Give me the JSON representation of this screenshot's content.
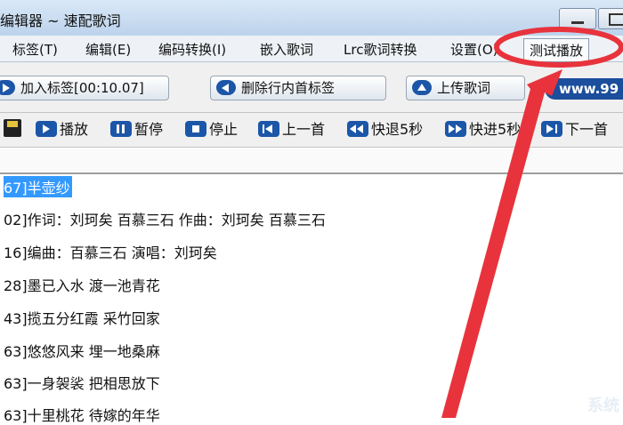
{
  "window": {
    "title": "歌词编辑器 ~ 速配歌词"
  },
  "menu": [
    {
      "label": "标签(T)"
    },
    {
      "label": "编辑(E)"
    },
    {
      "label": "编码转换(I)"
    },
    {
      "label": "嵌入歌词"
    },
    {
      "label": "Lrc歌词转换"
    },
    {
      "label": "设置(O)"
    },
    {
      "label": "测试播放"
    }
  ],
  "toolbar1": {
    "add_tag": "加入标签[00:10.07]",
    "delete_tag": "删除行内首标签",
    "upload": "上传歌词",
    "site": "www.99"
  },
  "toolbar2": {
    "play": "播放",
    "pause": "暂停",
    "stop": "停止",
    "prev": "上一首",
    "rewind": "快退5秒",
    "forward": "快进5秒",
    "next": "下一首"
  },
  "lyrics": [
    "67]半壶纱",
    "02]作词：刘珂矣  百慕三石  作曲：刘珂矣  百慕三石",
    "16]编曲：百慕三石  演唱：刘珂矣",
    "28]墨已入水  渡一池青花",
    "43]揽五分红霞  采竹回家",
    "63]悠悠风来  埋一地桑麻",
    "63]一身袈裟  把相思放下",
    "63]十里桃花  待嫁的年华"
  ],
  "watermark": "系统",
  "colors": {
    "annotation": "#e8333c",
    "selection": "#3399ff",
    "icon": "#1c56a8"
  }
}
